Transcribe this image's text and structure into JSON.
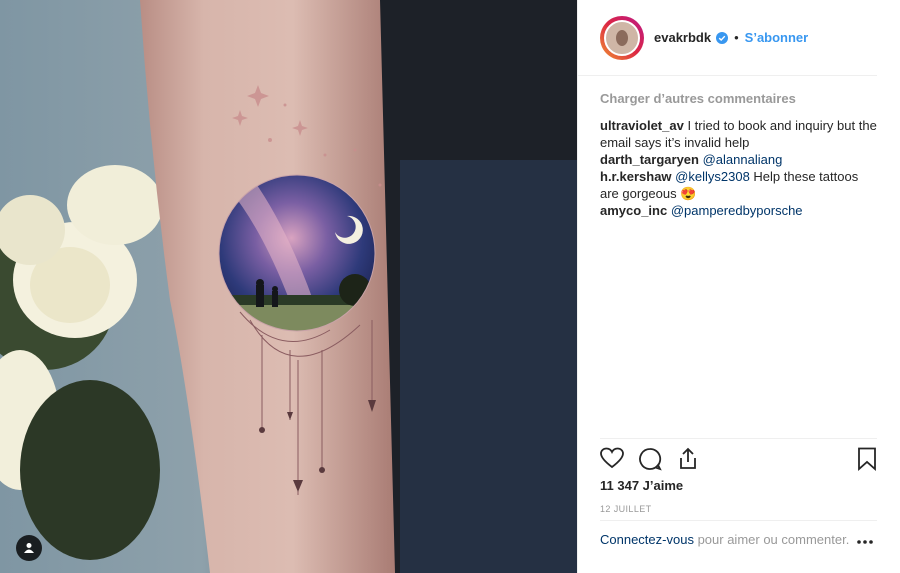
{
  "post": {
    "username": "evakrbdk",
    "follow_label": "S’abonner",
    "separator": "•"
  },
  "comments": {
    "load_more": "Charger d’autres commentaires",
    "items": [
      {
        "user": "ultraviolet_av",
        "text": "I tried to book and inquiry but the email says it’s invalid help",
        "mention": ""
      },
      {
        "user": "darth_targaryen",
        "text": "",
        "mention": "@alannaliang"
      },
      {
        "user": "h.r.kershaw",
        "mention": "@kellys2308",
        "text": "Help these tattoos are gorgeous 😍"
      },
      {
        "user": "amyco_inc",
        "text": "",
        "mention": "@pamperedbyporsche"
      }
    ]
  },
  "stats": {
    "likes": "11 347 J’aime",
    "date": "12 JUILLET"
  },
  "login": {
    "link": "Connectez-vous",
    "text": " pour aimer ou commenter."
  },
  "icons": {
    "like": "heart-icon",
    "comment": "comment-icon",
    "share": "share-icon",
    "save": "bookmark-icon",
    "more": "more-icon",
    "tagged": "user-tag-icon",
    "verified": "verified-badge-icon"
  },
  "colors": {
    "accent": "#3897f0",
    "mention": "#003569"
  }
}
